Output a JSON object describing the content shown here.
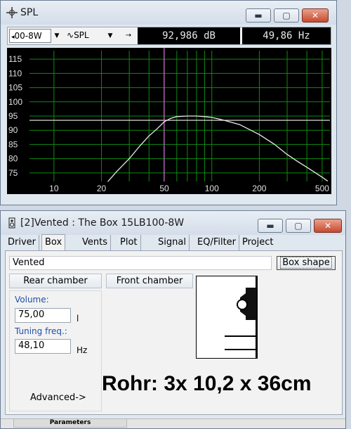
{
  "spl_window": {
    "title": "SPL",
    "toolbar": {
      "driver_combo": "00-8W",
      "mode_combo": "SPL",
      "mode_icon": "wave-icon",
      "scroll_btn": "→",
      "readout_db": "92,986 dB",
      "readout_hz": "49,86 Hz"
    }
  },
  "chart_data": {
    "type": "line",
    "x_scale": "log",
    "xlim": [
      7,
      560
    ],
    "ylim": [
      72,
      118
    ],
    "x_ticks": [
      "10",
      "20",
      "50",
      "100",
      "200",
      "500"
    ],
    "y_ticks": [
      "115",
      "110",
      "105",
      "100",
      "95",
      "90",
      "85",
      "80",
      "75"
    ],
    "grid": true,
    "cursor_x": 49.86,
    "reference_y": 93.5,
    "series": [
      {
        "color": "#e8e8e8",
        "x": [
          22,
          25,
          30,
          35,
          40,
          45,
          50,
          55,
          60,
          70,
          80,
          90,
          100,
          110,
          120,
          150,
          200,
          250,
          300,
          350,
          400,
          500,
          540
        ],
        "y": [
          72.0,
          75.5,
          80.0,
          84.5,
          88.0,
          90.5,
          93.0,
          94.2,
          94.8,
          95.0,
          95.0,
          94.8,
          94.5,
          94.0,
          93.5,
          92.0,
          88.5,
          85.0,
          81.5,
          79.0,
          77.0,
          73.5,
          72.2
        ]
      }
    ]
  },
  "box_window": {
    "title": "[2]Vented : The Box 15LB100-8W",
    "tabs": [
      "Driver",
      "Box",
      "Vents",
      "Plot",
      "Signal",
      "EQ/Filter",
      "Project"
    ],
    "active_tab": "Box",
    "box_type": "Vented",
    "box_shape_btn": "Box shape",
    "rear_chamber_btn": "Rear chamber",
    "front_chamber_btn": "Front chamber",
    "volume_label": "Volume:",
    "volume_value": "75,00",
    "volume_unit": "l",
    "tuning_label": "Tuning freq.:",
    "tuning_value": "48,10",
    "tuning_unit": "Hz",
    "advanced_btn": "Advanced->",
    "annotation": "Rohr: 3x 10,2 x 36cm",
    "status_tab": "Parameters"
  }
}
